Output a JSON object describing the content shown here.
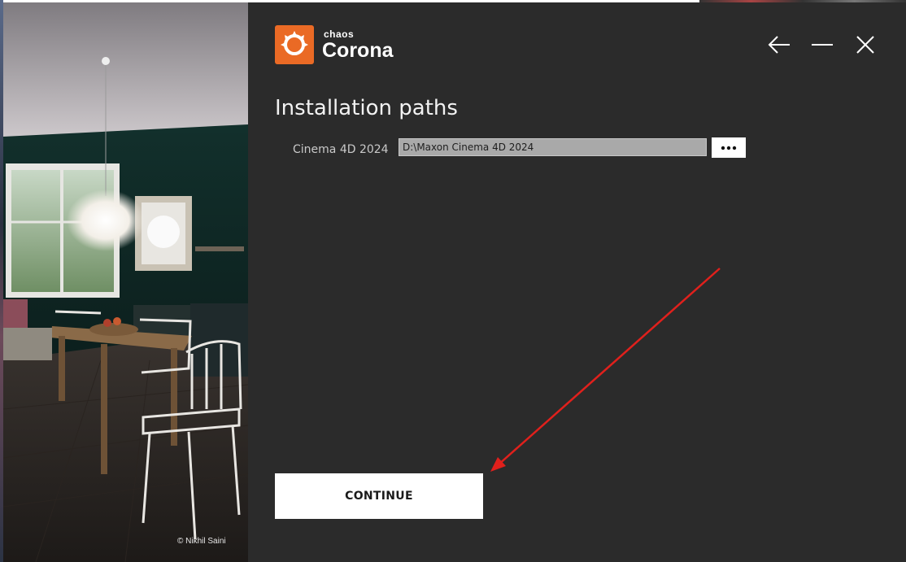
{
  "photo": {
    "credit": "© Nikhil Saini"
  },
  "logo": {
    "brand_small": "chaos",
    "brand_large": "Corona",
    "accent": "#ea6a25"
  },
  "window_controls": {
    "back_icon": "arrow-left-icon",
    "minimize_icon": "minimize-icon",
    "close_icon": "close-icon"
  },
  "main": {
    "title": "Installation paths",
    "paths": [
      {
        "label": "Cinema 4D 2024",
        "value": "D:\\Maxon Cinema 4D 2024",
        "browse_icon": "ellipsis-icon"
      }
    ],
    "continue_label": "CONTINUE"
  },
  "annotation": {
    "color": "#e0201c"
  }
}
